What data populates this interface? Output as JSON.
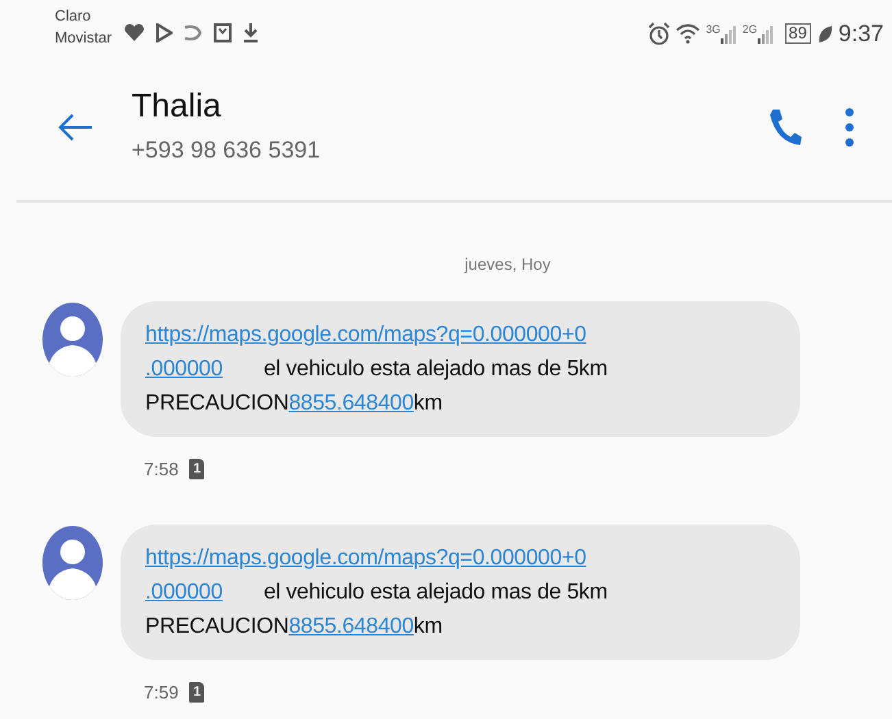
{
  "status_bar": {
    "carriers": [
      "Claro",
      "Movistar"
    ],
    "signals": [
      "3G",
      "2G"
    ],
    "battery": "89",
    "time": "9:37"
  },
  "header": {
    "name": "Thalia",
    "phone": "+593 98 636 5391"
  },
  "date_divider": "jueves, Hoy",
  "messages": [
    {
      "lines": [
        [
          {
            "kind": "link",
            "text": "https://maps.google.com/maps?q=0.000000+0"
          }
        ],
        [
          {
            "kind": "link",
            "text": ".000000"
          },
          {
            "kind": "gap"
          },
          {
            "kind": "text",
            "text": "el vehiculo esta alejado mas de 5km"
          }
        ],
        [
          {
            "kind": "text",
            "text": "PRECAUCION"
          },
          {
            "kind": "link",
            "text": "8855.648400"
          },
          {
            "kind": "text",
            "text": "km"
          }
        ]
      ],
      "time": "7:58",
      "sim": "1"
    },
    {
      "lines": [
        [
          {
            "kind": "link",
            "text": "https://maps.google.com/maps?q=0.000000+0"
          }
        ],
        [
          {
            "kind": "link",
            "text": ".000000"
          },
          {
            "kind": "gap"
          },
          {
            "kind": "text",
            "text": "el vehiculo esta alejado mas de 5km"
          }
        ],
        [
          {
            "kind": "text",
            "text": "PRECAUCION"
          },
          {
            "kind": "link",
            "text": "8855.648400"
          },
          {
            "kind": "text",
            "text": "km"
          }
        ]
      ],
      "time": "7:59",
      "sim": "1"
    }
  ]
}
